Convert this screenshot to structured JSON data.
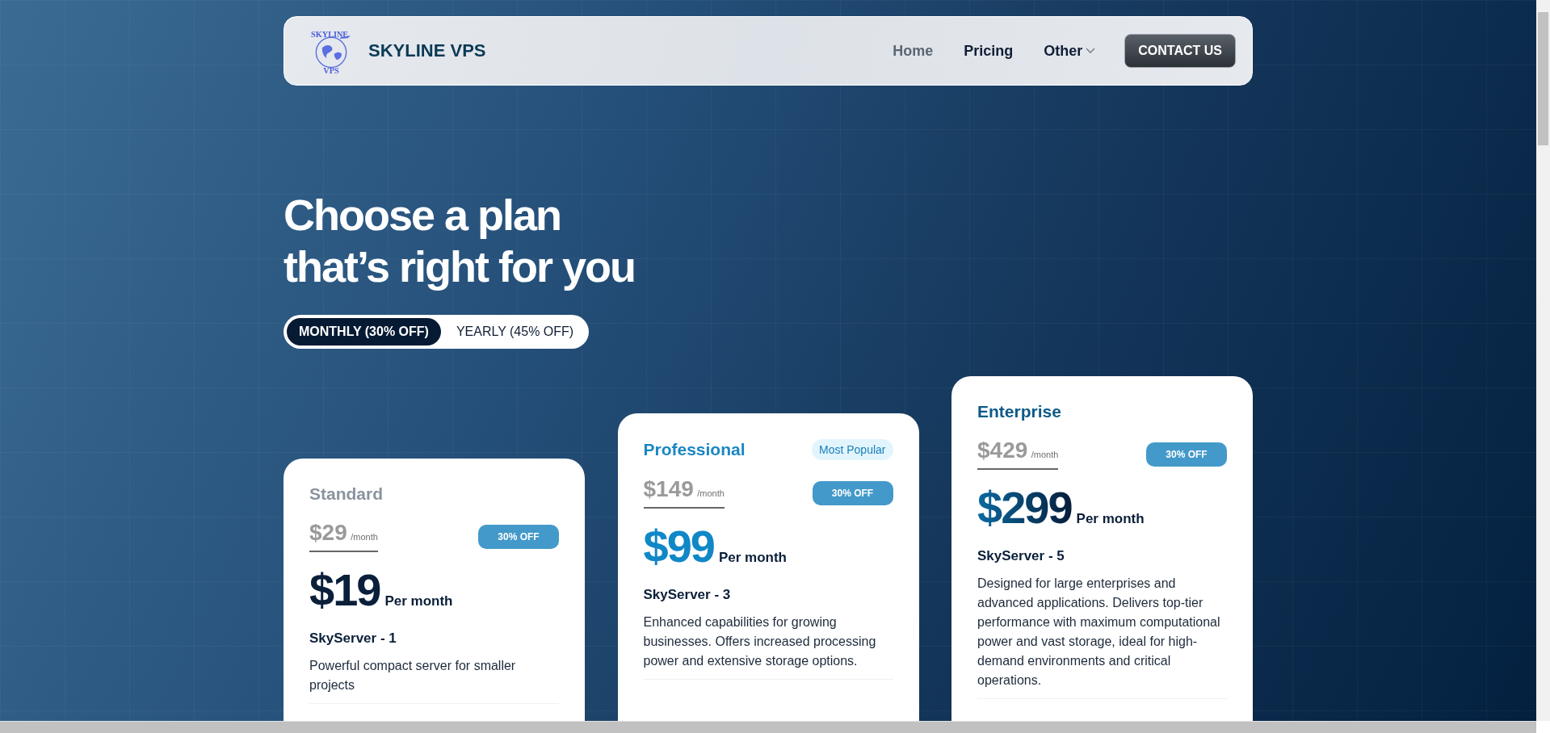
{
  "header": {
    "logo": {
      "top": "SKYLINE",
      "bottom": "VPS"
    },
    "brand": "SKYLINE VPS",
    "nav": [
      {
        "label": "Home",
        "selected": true,
        "dropdown": false
      },
      {
        "label": "Pricing",
        "selected": false,
        "dropdown": false
      },
      {
        "label": "Other",
        "selected": false,
        "dropdown": true
      }
    ],
    "cta": "CONTACT US"
  },
  "heading": [
    "Choose a plan",
    "that’s right for you"
  ],
  "billing_toggle": [
    {
      "label": "MONTHLY (30% OFF)",
      "selected": true
    },
    {
      "label": "YEARLY (45% OFF)",
      "selected": false
    }
  ],
  "plans": [
    {
      "kind": "standard",
      "name": "Standard",
      "old_price": "$29",
      "old_unit": "/month",
      "discount": "30% OFF",
      "price": "$19",
      "price_unit": "Per month",
      "server": "SkyServer - 1",
      "description": "Powerful compact server for smaller projects"
    },
    {
      "kind": "professional",
      "name": "Professional",
      "badge": "Most Popular",
      "old_price": "$149",
      "old_unit": "/month",
      "discount": "30% OFF",
      "price": "$99",
      "price_unit": "Per month",
      "server": "SkyServer - 3",
      "description": "Enhanced capabilities for growing businesses. Offers increased processing power and extensive storage options."
    },
    {
      "kind": "enterprise",
      "name": "Enterprise",
      "old_price": "$429",
      "old_unit": "/month",
      "discount": "30% OFF",
      "price": "$299",
      "price_unit": "Per month",
      "server": "SkyServer - 5",
      "description": "Designed for large enterprises and advanced applications. Delivers top-tier performance with maximum computational power and vast storage, ideal for high-demand environments and critical operations."
    }
  ]
}
